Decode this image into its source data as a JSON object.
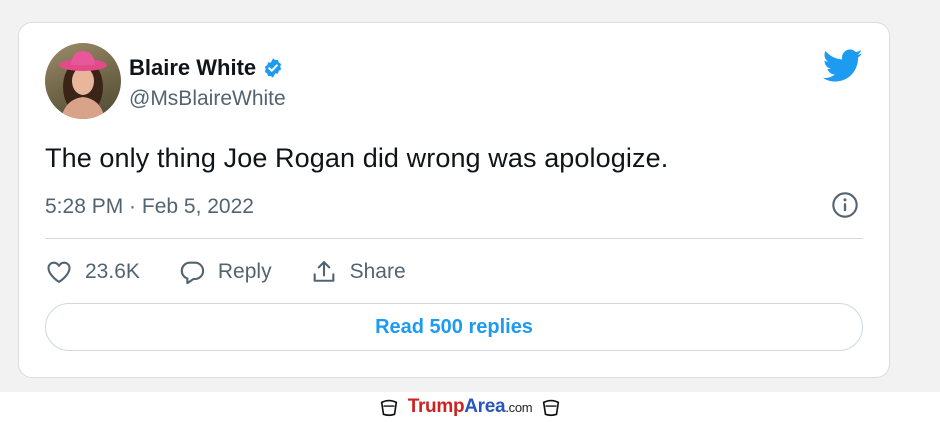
{
  "tweet": {
    "author_name": "Blaire White",
    "handle": "@MsBlaireWhite",
    "text": "The only thing Joe Rogan did wrong was apologize.",
    "timestamp": "5:28 PM · Feb 5, 2022",
    "like_count": "23.6K",
    "reply_label": "Reply",
    "share_label": "Share",
    "read_replies_label": "Read 500 replies"
  },
  "icons": {
    "brand": "twitter-bird-icon",
    "verified": "verified-badge-icon",
    "info": "info-icon",
    "like": "heart-icon",
    "reply": "reply-bubble-icon",
    "share": "share-icon"
  },
  "watermark": {
    "brand_part1": "Trump",
    "brand_part2": "Area",
    "brand_suffix": ".com"
  },
  "colors": {
    "accent": "#1d9bf0",
    "text": "#0f1419",
    "secondary_text": "#536471",
    "watermark_red": "#cc2222",
    "watermark_blue": "#2a56b8"
  }
}
